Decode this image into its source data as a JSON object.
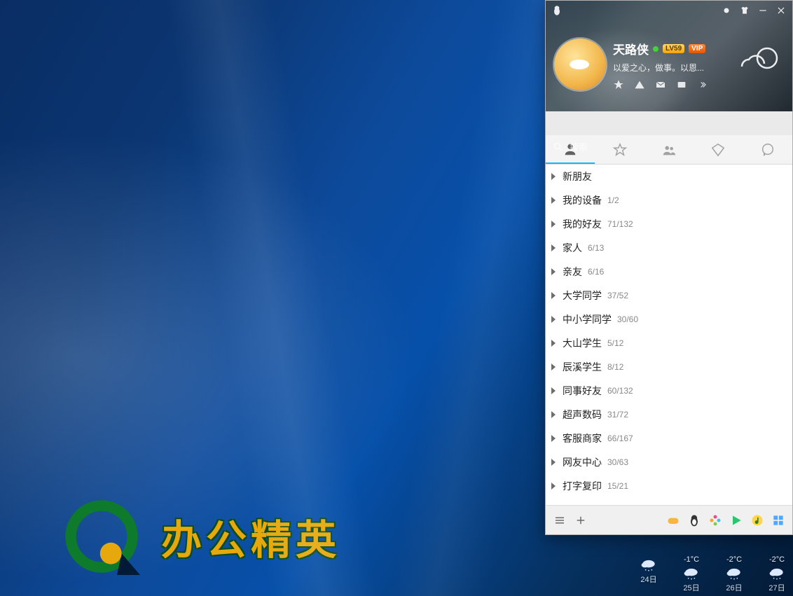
{
  "desktop": {
    "logo_text": "办公精英"
  },
  "qq": {
    "user": {
      "name": "天路侠",
      "level": "LV59",
      "vip": "VIP",
      "signature": "以爱之心，做事。以恩..."
    },
    "search_placeholder": "搜索",
    "groups": [
      {
        "name": "新朋友",
        "count": ""
      },
      {
        "name": "我的设备",
        "count": "1/2"
      },
      {
        "name": "我的好友",
        "count": "71/132"
      },
      {
        "name": "家人",
        "count": "6/13"
      },
      {
        "name": "亲友",
        "count": "6/16"
      },
      {
        "name": "大学同学",
        "count": "37/52"
      },
      {
        "name": "中小学同学",
        "count": "30/60"
      },
      {
        "name": "大山学生",
        "count": "5/12"
      },
      {
        "name": "辰溪学生",
        "count": "8/12"
      },
      {
        "name": "同事好友",
        "count": "60/132"
      },
      {
        "name": "超声数码",
        "count": "31/72"
      },
      {
        "name": "客服商家",
        "count": "66/167"
      },
      {
        "name": "网友中心",
        "count": "30/63"
      },
      {
        "name": "打字复印",
        "count": "15/21"
      }
    ]
  },
  "weather": [
    {
      "temp": "",
      "day": "24日"
    },
    {
      "temp": "-1°C",
      "day": "25日"
    },
    {
      "temp": "-2°C",
      "day": "26日"
    },
    {
      "temp": "-2°C",
      "day": "27日"
    }
  ]
}
